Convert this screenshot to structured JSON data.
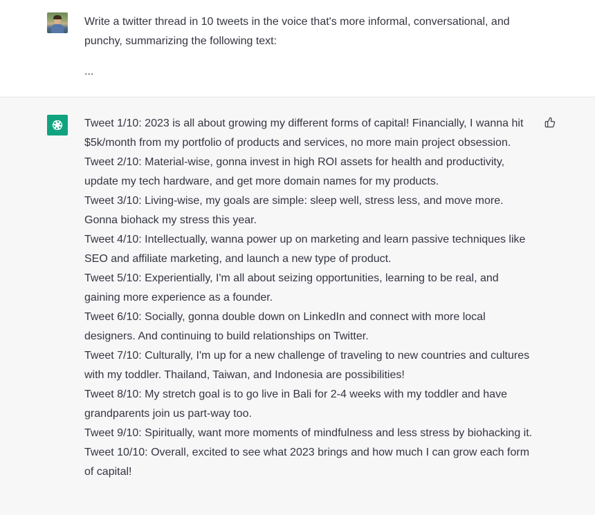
{
  "conversation": {
    "user_message": {
      "avatar": "user-avatar",
      "prompt": "Write a twitter thread in 10 tweets in the voice that's more informal, conversational, and punchy, summarizing the following text:",
      "ellipsis": "..."
    },
    "assistant_message": {
      "avatar": "openai-logo-icon",
      "tweets": [
        "Tweet 1/10: 2023 is all about growing my different forms of capital! Financially, I wanna hit $5k/month from my portfolio of products and services, no more main project obsession.",
        "Tweet 2/10: Material-wise, gonna invest in high ROI assets for health and productivity, update my tech hardware, and get more domain names for my products.",
        "Tweet 3/10: Living-wise, my goals are simple: sleep well, stress less, and move more. Gonna biohack my stress this year.",
        "Tweet 4/10: Intellectually, wanna power up on marketing and learn passive techniques like SEO and affiliate marketing, and launch a new type of product.",
        "Tweet 5/10: Experientially, I'm all about seizing opportunities, learning to be real, and gaining more experience as a founder.",
        "Tweet 6/10: Socially, gonna double down on LinkedIn and connect with more local designers. And continuing to build relationships on Twitter.",
        "Tweet 7/10: Culturally, I'm up for a new challenge of traveling to new countries and cultures with my toddler. Thailand, Taiwan, and Indonesia are possibilities!",
        "Tweet 8/10: My stretch goal is to go live in Bali for 2-4 weeks with my toddler and have grandparents join us part-way too.",
        "Tweet 9/10: Spiritually, want more moments of mindfulness and less stress by biohacking it.",
        "Tweet 10/10: Overall, excited to see what 2023 brings and how much I can grow each form of capital!"
      ],
      "feedback_icon": "thumbs-up-icon"
    }
  },
  "colors": {
    "assistant_bg": "#f7f7f8",
    "user_bg": "#ffffff",
    "brand_green": "#10a37f",
    "text": "#343541"
  }
}
